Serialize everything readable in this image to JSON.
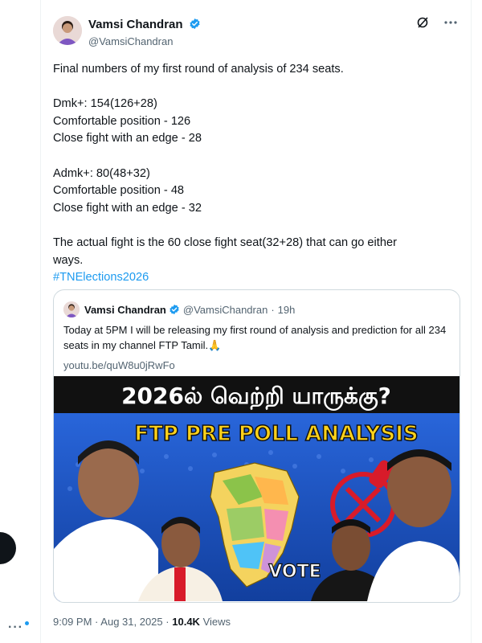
{
  "author": {
    "display_name": "Vamsi Chandran",
    "handle": "@VamsiChandran"
  },
  "icons": {
    "verified": "verified-badge-icon",
    "grok": "grok-slash-icon",
    "more": "more-options-icon"
  },
  "tweet": {
    "lines": [
      "Final numbers of my first round of analysis of 234 seats.",
      "",
      "Dmk+: 154(126+28)",
      "Comfortable position - 126",
      "Close fight with an edge - 28",
      "",
      "Admk+: 80(48+32)",
      "Comfortable position - 48",
      "Close fight with an edge - 32",
      "",
      "The actual fight is the 60 close fight seat(32+28) that can go either",
      "ways."
    ],
    "hashtag": "#TNElections2026"
  },
  "quote": {
    "display_name": "Vamsi Chandran",
    "handle": "@VamsiChandran",
    "separator": "·",
    "time": "19h",
    "text": "Today at 5PM I will be releasing my first round of analysis and prediction for all 234 seats in my channel FTP Tamil.🙏",
    "link": "youtu.be/quW8u0jRwFo"
  },
  "thumbnail": {
    "headline": "2026ல் வெற்றி யாருக்கு?",
    "banner": "FTP PRE POLL ANALYSIS",
    "vote_label": "VOTE",
    "colors": {
      "background": "#1e5bd6",
      "headline": "#ffffff",
      "banner": "#ffd21a",
      "stamp": "#d81b2a"
    }
  },
  "footer": {
    "time": "9:09 PM",
    "separator": "·",
    "date": "Aug 31, 2025",
    "views_count": "10.4K",
    "views_label": "Views"
  },
  "colors": {
    "accent": "#1d9bf0",
    "text": "#0f1419",
    "secondary": "#536471",
    "border": "#cfd9de"
  }
}
